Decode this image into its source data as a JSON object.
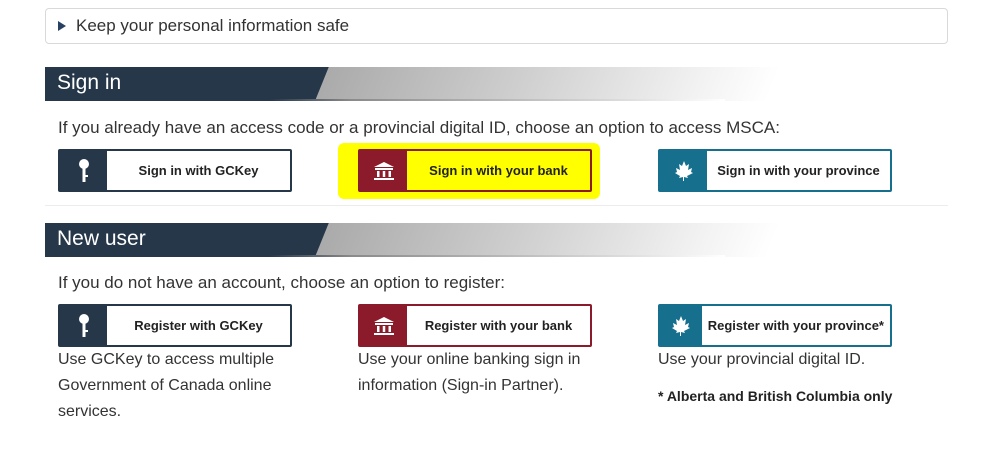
{
  "details": {
    "label": "Keep your personal information safe"
  },
  "sign_in": {
    "title": "Sign in",
    "intro": "If you already have an access code or a provincial digital ID, choose an option to access MSCA:",
    "buttons": {
      "gckey": "Sign in with GCKey",
      "bank": "Sign in with your bank",
      "province": "Sign in with your province"
    }
  },
  "new_user": {
    "title": "New user",
    "intro": "If you do not have an account, choose an option to register:",
    "buttons": {
      "gckey": "Register with GCKey",
      "bank": "Register with your bank",
      "province": "Register with your province*"
    },
    "descriptions": {
      "gckey": "Use GCKey to access multiple Government of Canada online services.",
      "bank": "Use your online banking sign in information (Sign-in Partner).",
      "province": "Use your provincial digital ID."
    },
    "note": "* Alberta and British Columbia only"
  },
  "icons": {
    "gckey": "key-icon",
    "bank": "bank-icon",
    "province": "maple-leaf-icon"
  },
  "colors": {
    "gckey": "#26374a",
    "bank": "#8b1a2b",
    "province": "#16708d",
    "highlight": "#ffff00"
  }
}
